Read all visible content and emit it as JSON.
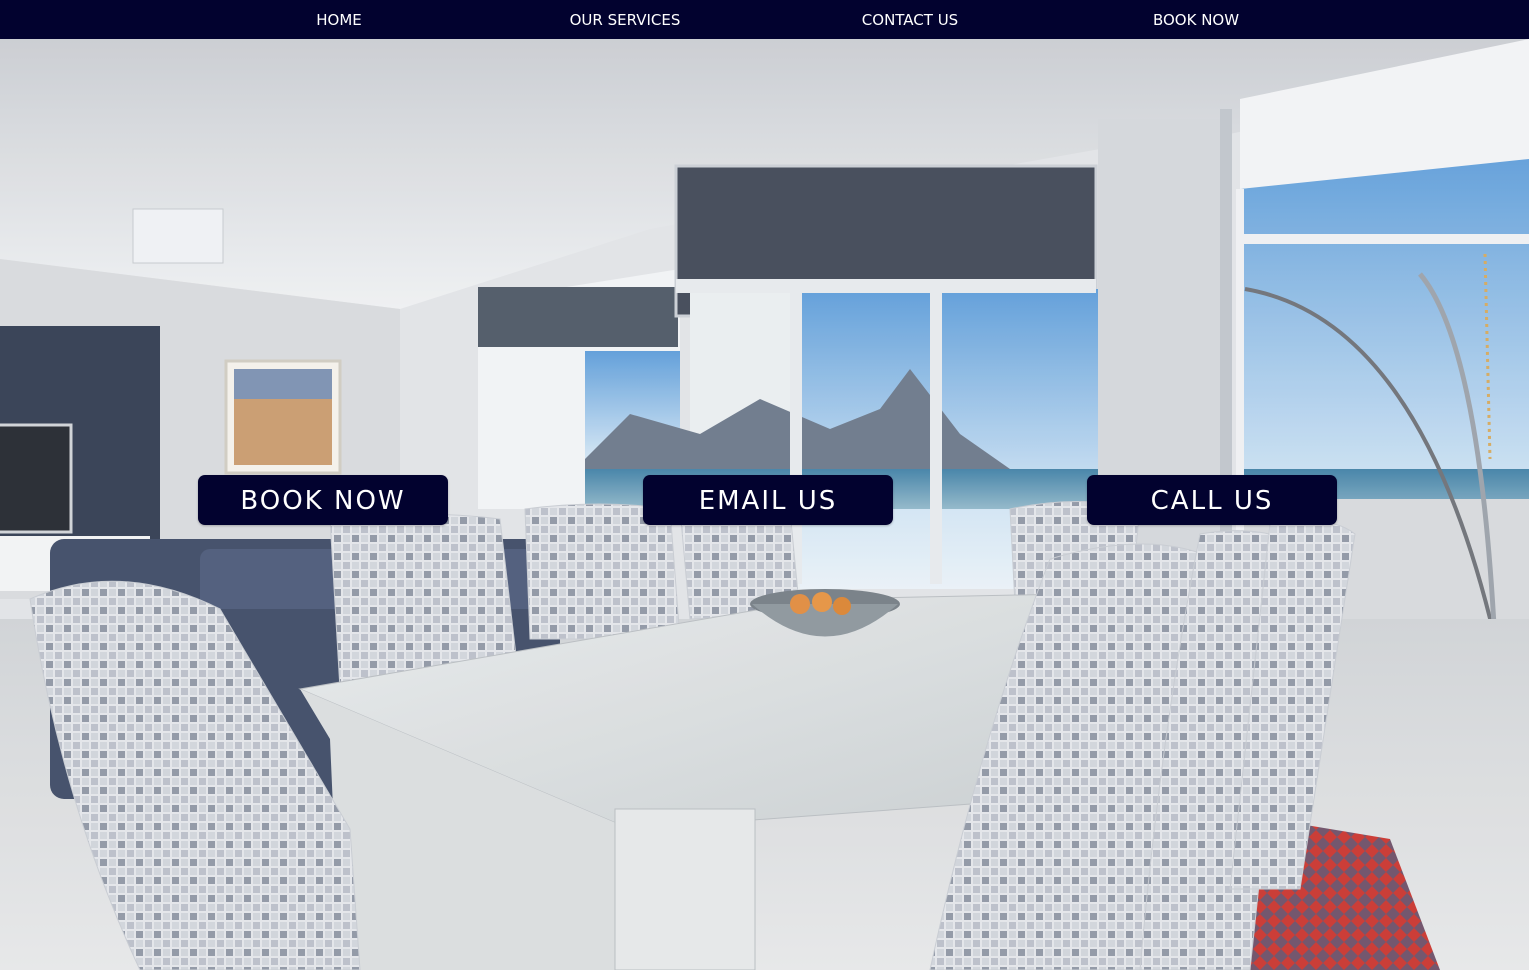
{
  "nav": {
    "home": "HOME",
    "services": "OUR SERVICES",
    "contact": "CONTACT US",
    "book": "BOOK NOW"
  },
  "cta": {
    "book": "BOOK NOW",
    "email": "EMAIL US",
    "call": "CALL US"
  },
  "colors": {
    "navy": "#02022f",
    "text": "#ffffff"
  }
}
